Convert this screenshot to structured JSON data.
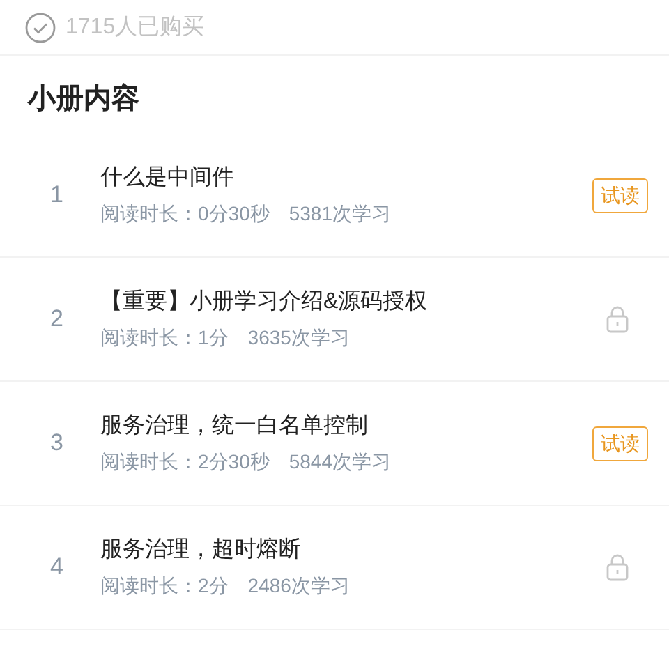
{
  "purchase": {
    "checked": true,
    "text": "1715人已购买"
  },
  "section_title": "小册内容",
  "chapters": [
    {
      "index": "1",
      "title": "什么是中间件",
      "duration": "阅读时长：0分30秒",
      "learners": "5381次学习",
      "kind": "trial",
      "badge": "试读"
    },
    {
      "index": "2",
      "title": "【重要】小册学习介绍&源码授权",
      "duration": "阅读时长：1分",
      "learners": "3635次学习",
      "kind": "locked"
    },
    {
      "index": "3",
      "title": "服务治理，统一白名单控制",
      "duration": "阅读时长：2分30秒",
      "learners": "5844次学习",
      "kind": "trial",
      "badge": "试读"
    },
    {
      "index": "4",
      "title": "服务治理，超时熔断",
      "duration": "阅读时长：2分",
      "learners": "2486次学习",
      "kind": "locked"
    }
  ]
}
